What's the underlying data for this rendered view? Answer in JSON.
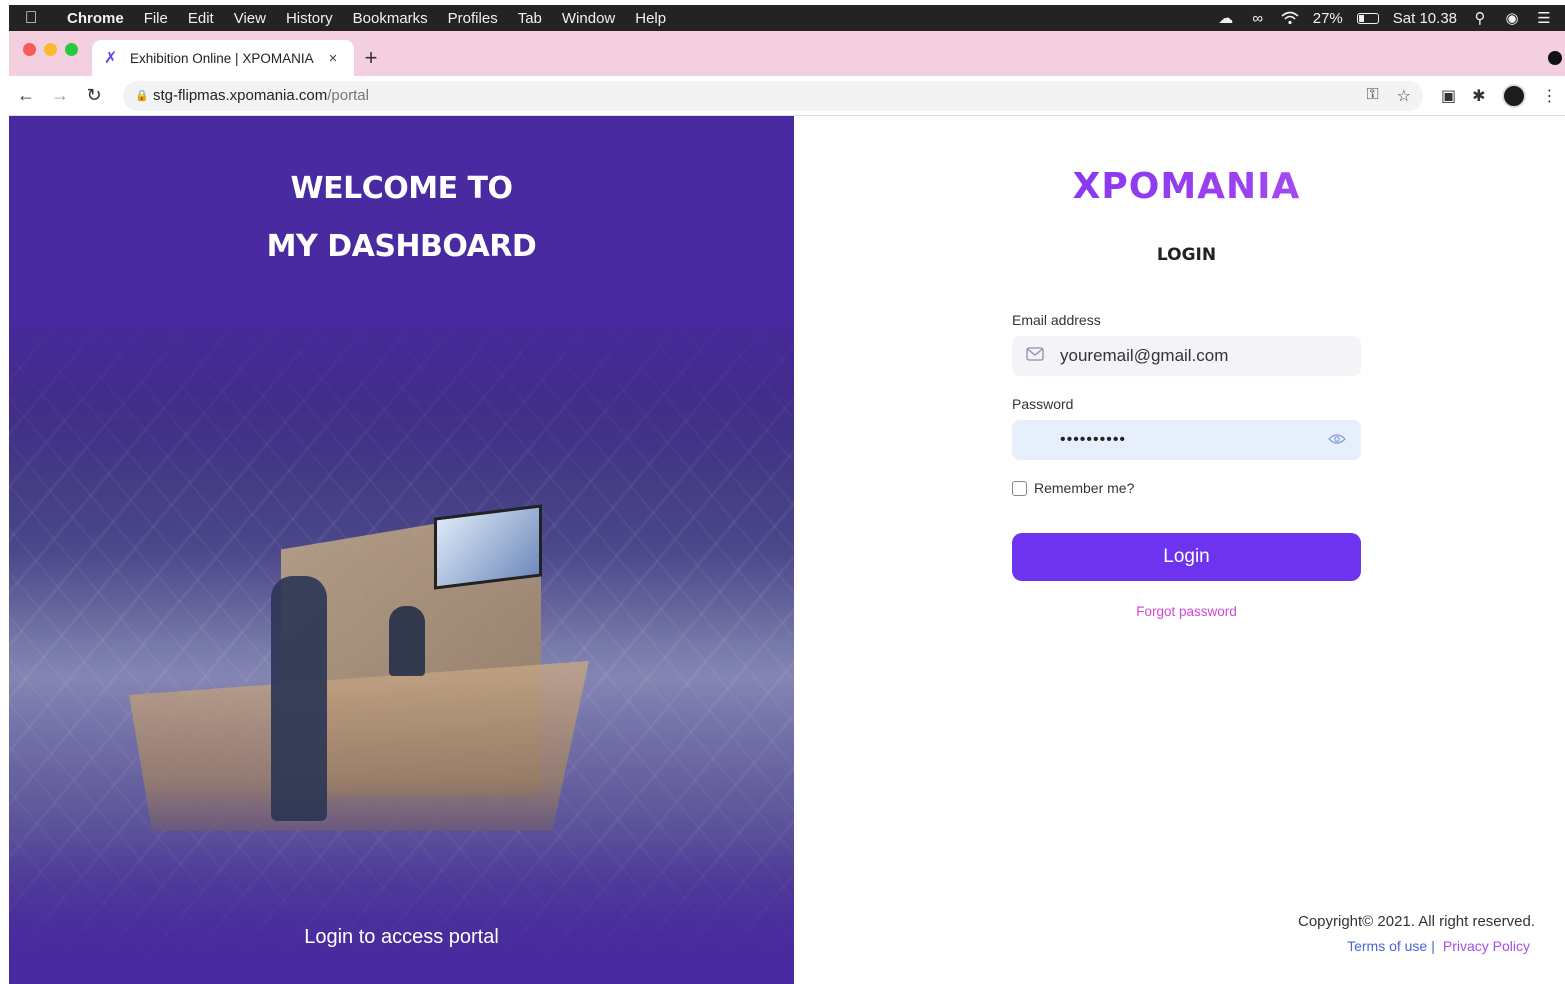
{
  "menubar": {
    "app_name": "Chrome",
    "items": [
      "File",
      "Edit",
      "View",
      "History",
      "Bookmarks",
      "Profiles",
      "Tab",
      "Window",
      "Help"
    ],
    "battery_percent": "27%",
    "battery_level": 0.27,
    "clock": "Sat 10.38"
  },
  "browser": {
    "tab_title": "Exhibition Online | XPOMANIA",
    "tab_close": "×",
    "new_tab": "+",
    "url_host": "stg-flipmas.xpomania.com",
    "url_path": "/portal"
  },
  "hero": {
    "title_line1": "WELCOME TO",
    "title_line2": "MY DASHBOARD",
    "caption": "Login to access portal"
  },
  "login": {
    "logo": "XPOMANIA",
    "heading": "LOGIN",
    "email_label": "Email address",
    "email_value": "youremail@gmail.com",
    "password_label": "Password",
    "password_value": "••••••••••",
    "remember_label": "Remember me?",
    "remember_checked": false,
    "button_label": "Login",
    "forgot_label": "Forgot password"
  },
  "footer": {
    "copyright": "Copyright© 2021. All right reserved.",
    "terms": "Terms of use",
    "separator": "|",
    "privacy": "Privacy Policy"
  },
  "colors": {
    "brand_purple": "#6d33ef",
    "hero_bg": "#4a2aa0",
    "forgot_link": "#d047d6",
    "tabstrip_bg": "#f4cfe0"
  }
}
